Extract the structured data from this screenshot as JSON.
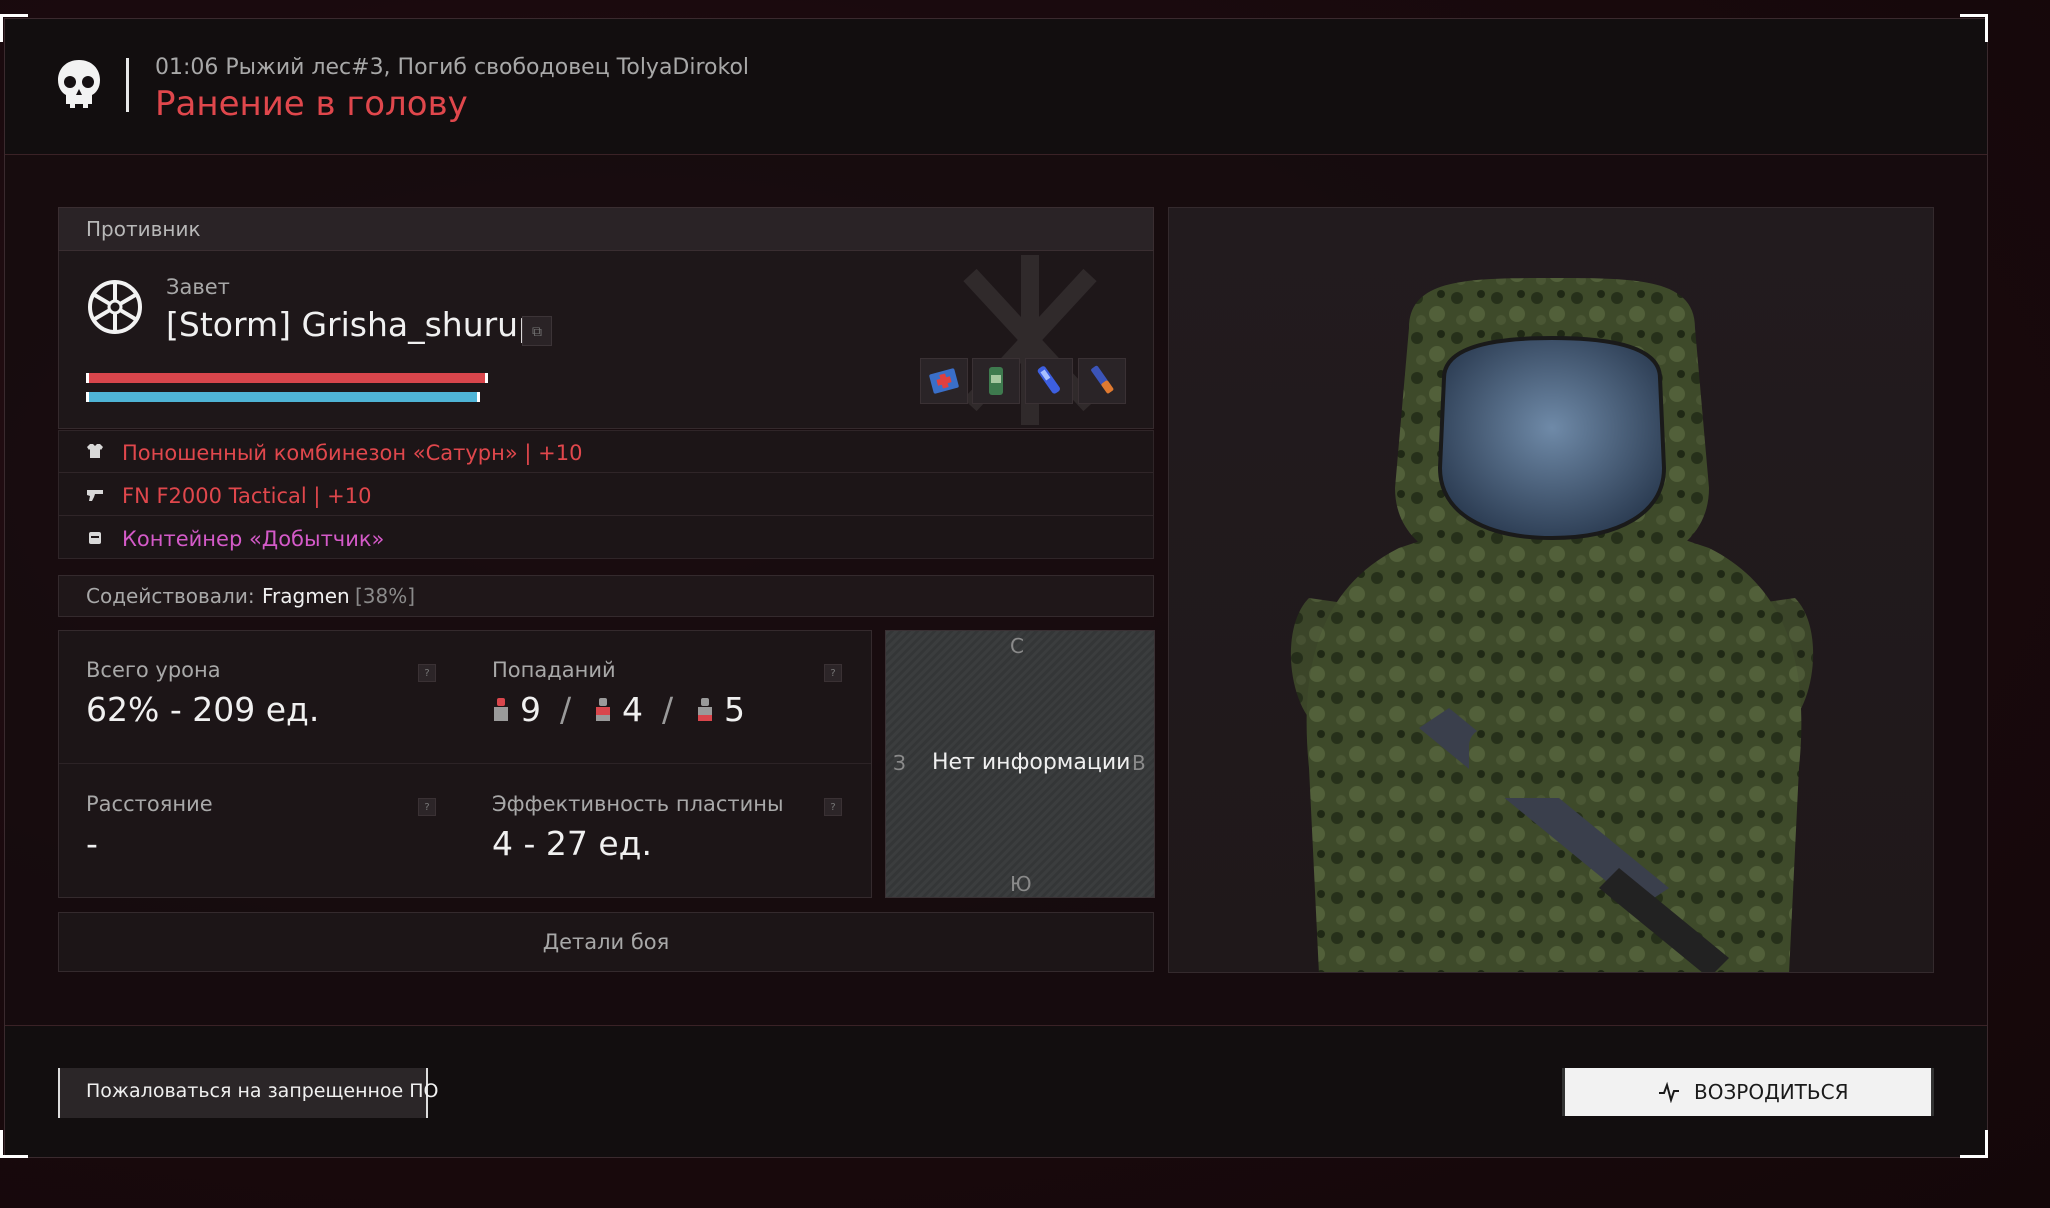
{
  "header": {
    "subtitle": "01:06 Рыжий лес#3, Погиб свободовец TolyaDirokol",
    "title": "Ранение в голову"
  },
  "enemy": {
    "section_label": "Противник",
    "faction": "Завет",
    "name": "[Storm] Grisha_shurup",
    "health_fraction": 1.0,
    "armor_fraction": 0.98,
    "quick_items": [
      "medkit-icon",
      "canister-icon",
      "injector-icon",
      "grenade-icon"
    ]
  },
  "equipment": [
    {
      "icon": "armor-icon",
      "text": "Поношенный комбинезон «Сатурн» | +10",
      "color": "#e0474c"
    },
    {
      "icon": "rifle-icon",
      "text": "FN F2000 Tactical | +10",
      "color": "#e0474c"
    },
    {
      "icon": "container-icon",
      "text": "Контейнер «Добытчик»",
      "color": "#d45ac8"
    }
  ],
  "assist": {
    "label": "Содействовали:",
    "name": "Fragmen",
    "percent": "[38%]"
  },
  "stats": {
    "total_damage": {
      "label": "Всего урона",
      "value": "62% - 209 ед."
    },
    "hits": {
      "label": "Попаданий",
      "head": "9",
      "body": "4",
      "legs": "5",
      "sep": "/"
    },
    "distance": {
      "label": "Расстояние",
      "value": "-"
    },
    "plate": {
      "label": "Эффективность пластины",
      "value": "4 - 27 ед."
    },
    "help": "?"
  },
  "minimap": {
    "north": "С",
    "south": "Ю",
    "west": "З",
    "east": "В",
    "message": "Нет информации"
  },
  "details_button": "Детали боя",
  "report_button": "Пожаловаться на запрещенное ПО",
  "respawn_button": "ВОЗРОДИТЬСЯ",
  "colors": {
    "accent_red": "#e0474c",
    "health": "#d9464c",
    "armor": "#4fb4d6",
    "container": "#d45ac8"
  }
}
